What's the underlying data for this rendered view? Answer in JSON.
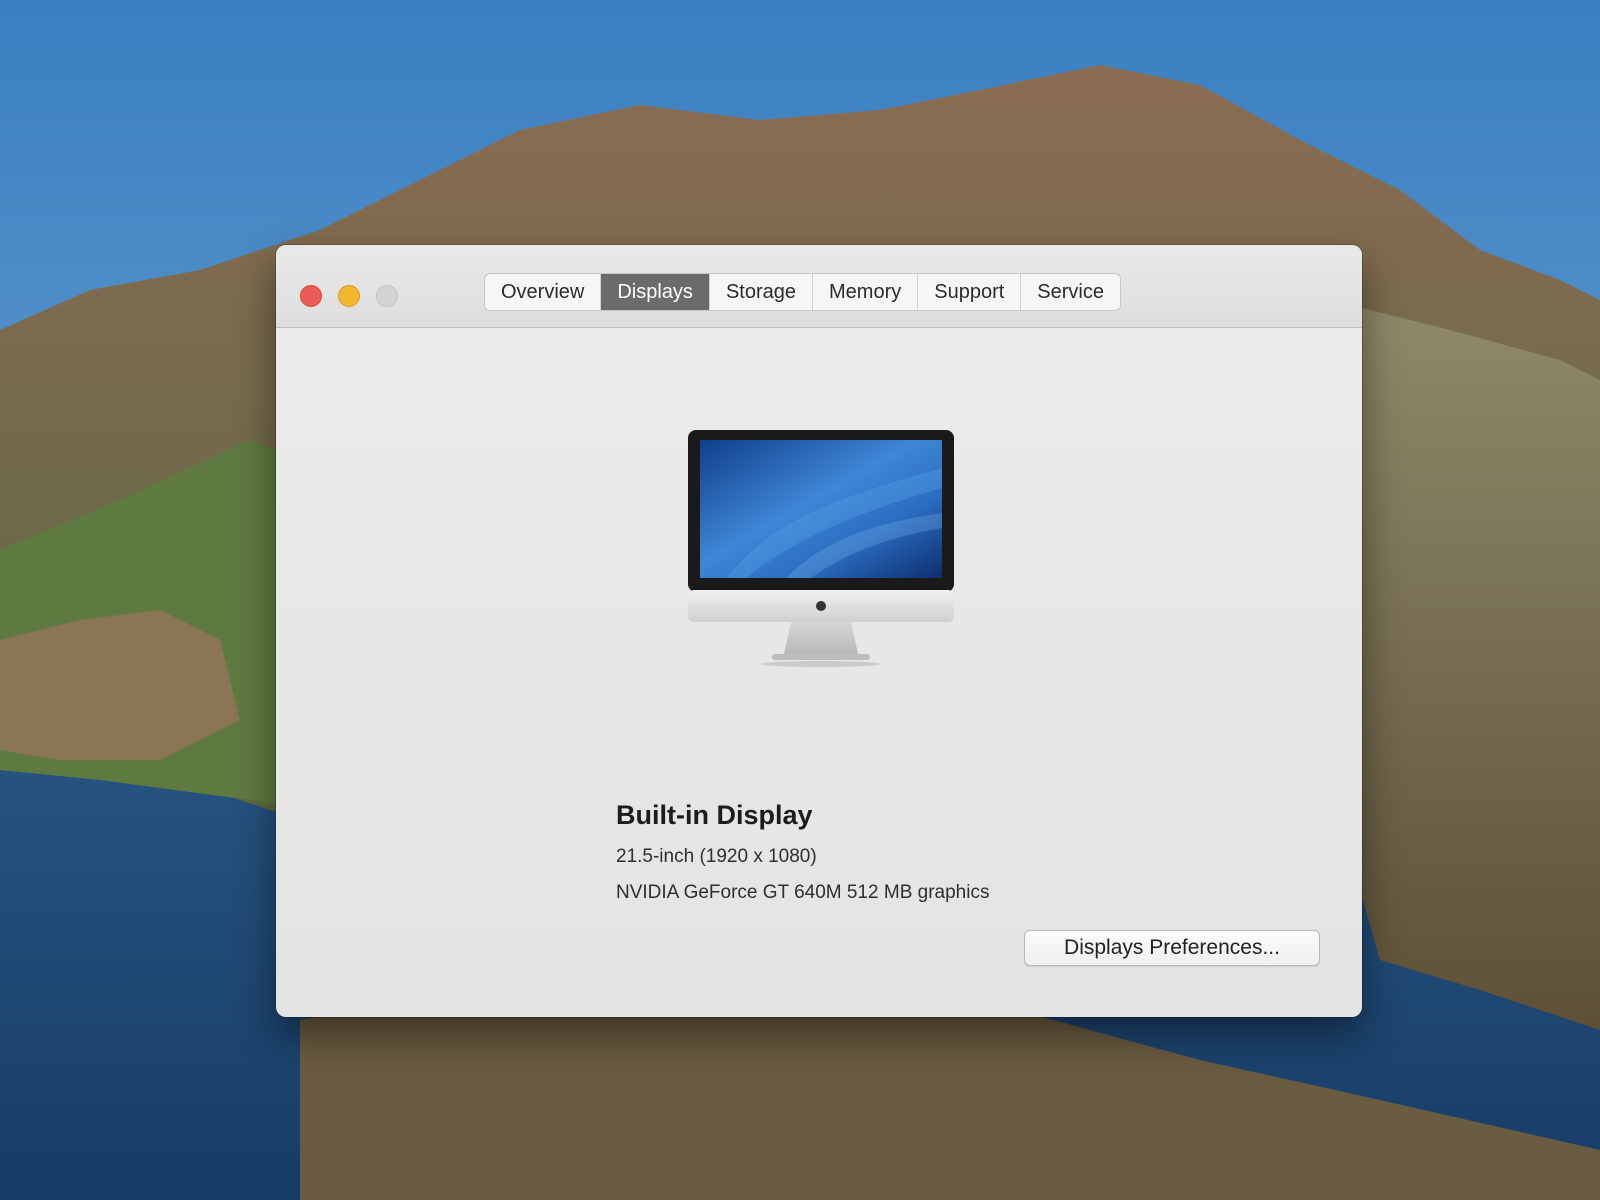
{
  "window": {
    "tabs": [
      {
        "label": "Overview",
        "active": false
      },
      {
        "label": "Displays",
        "active": true
      },
      {
        "label": "Storage",
        "active": false
      },
      {
        "label": "Memory",
        "active": false
      },
      {
        "label": "Support",
        "active": false
      },
      {
        "label": "Service",
        "active": false
      }
    ]
  },
  "display": {
    "icon": "imac-icon",
    "title": "Built-in Display",
    "size": "21.5-inch (1920 x 1080)",
    "graphics": "NVIDIA GeForce GT 640M 512 MB graphics"
  },
  "buttons": {
    "preferences_label": "Displays Preferences..."
  },
  "colors": {
    "close": "#ee5b55",
    "minimize": "#f3b72f",
    "zoom": "#d4d4d4",
    "active_tab": "#6b6b6b"
  }
}
